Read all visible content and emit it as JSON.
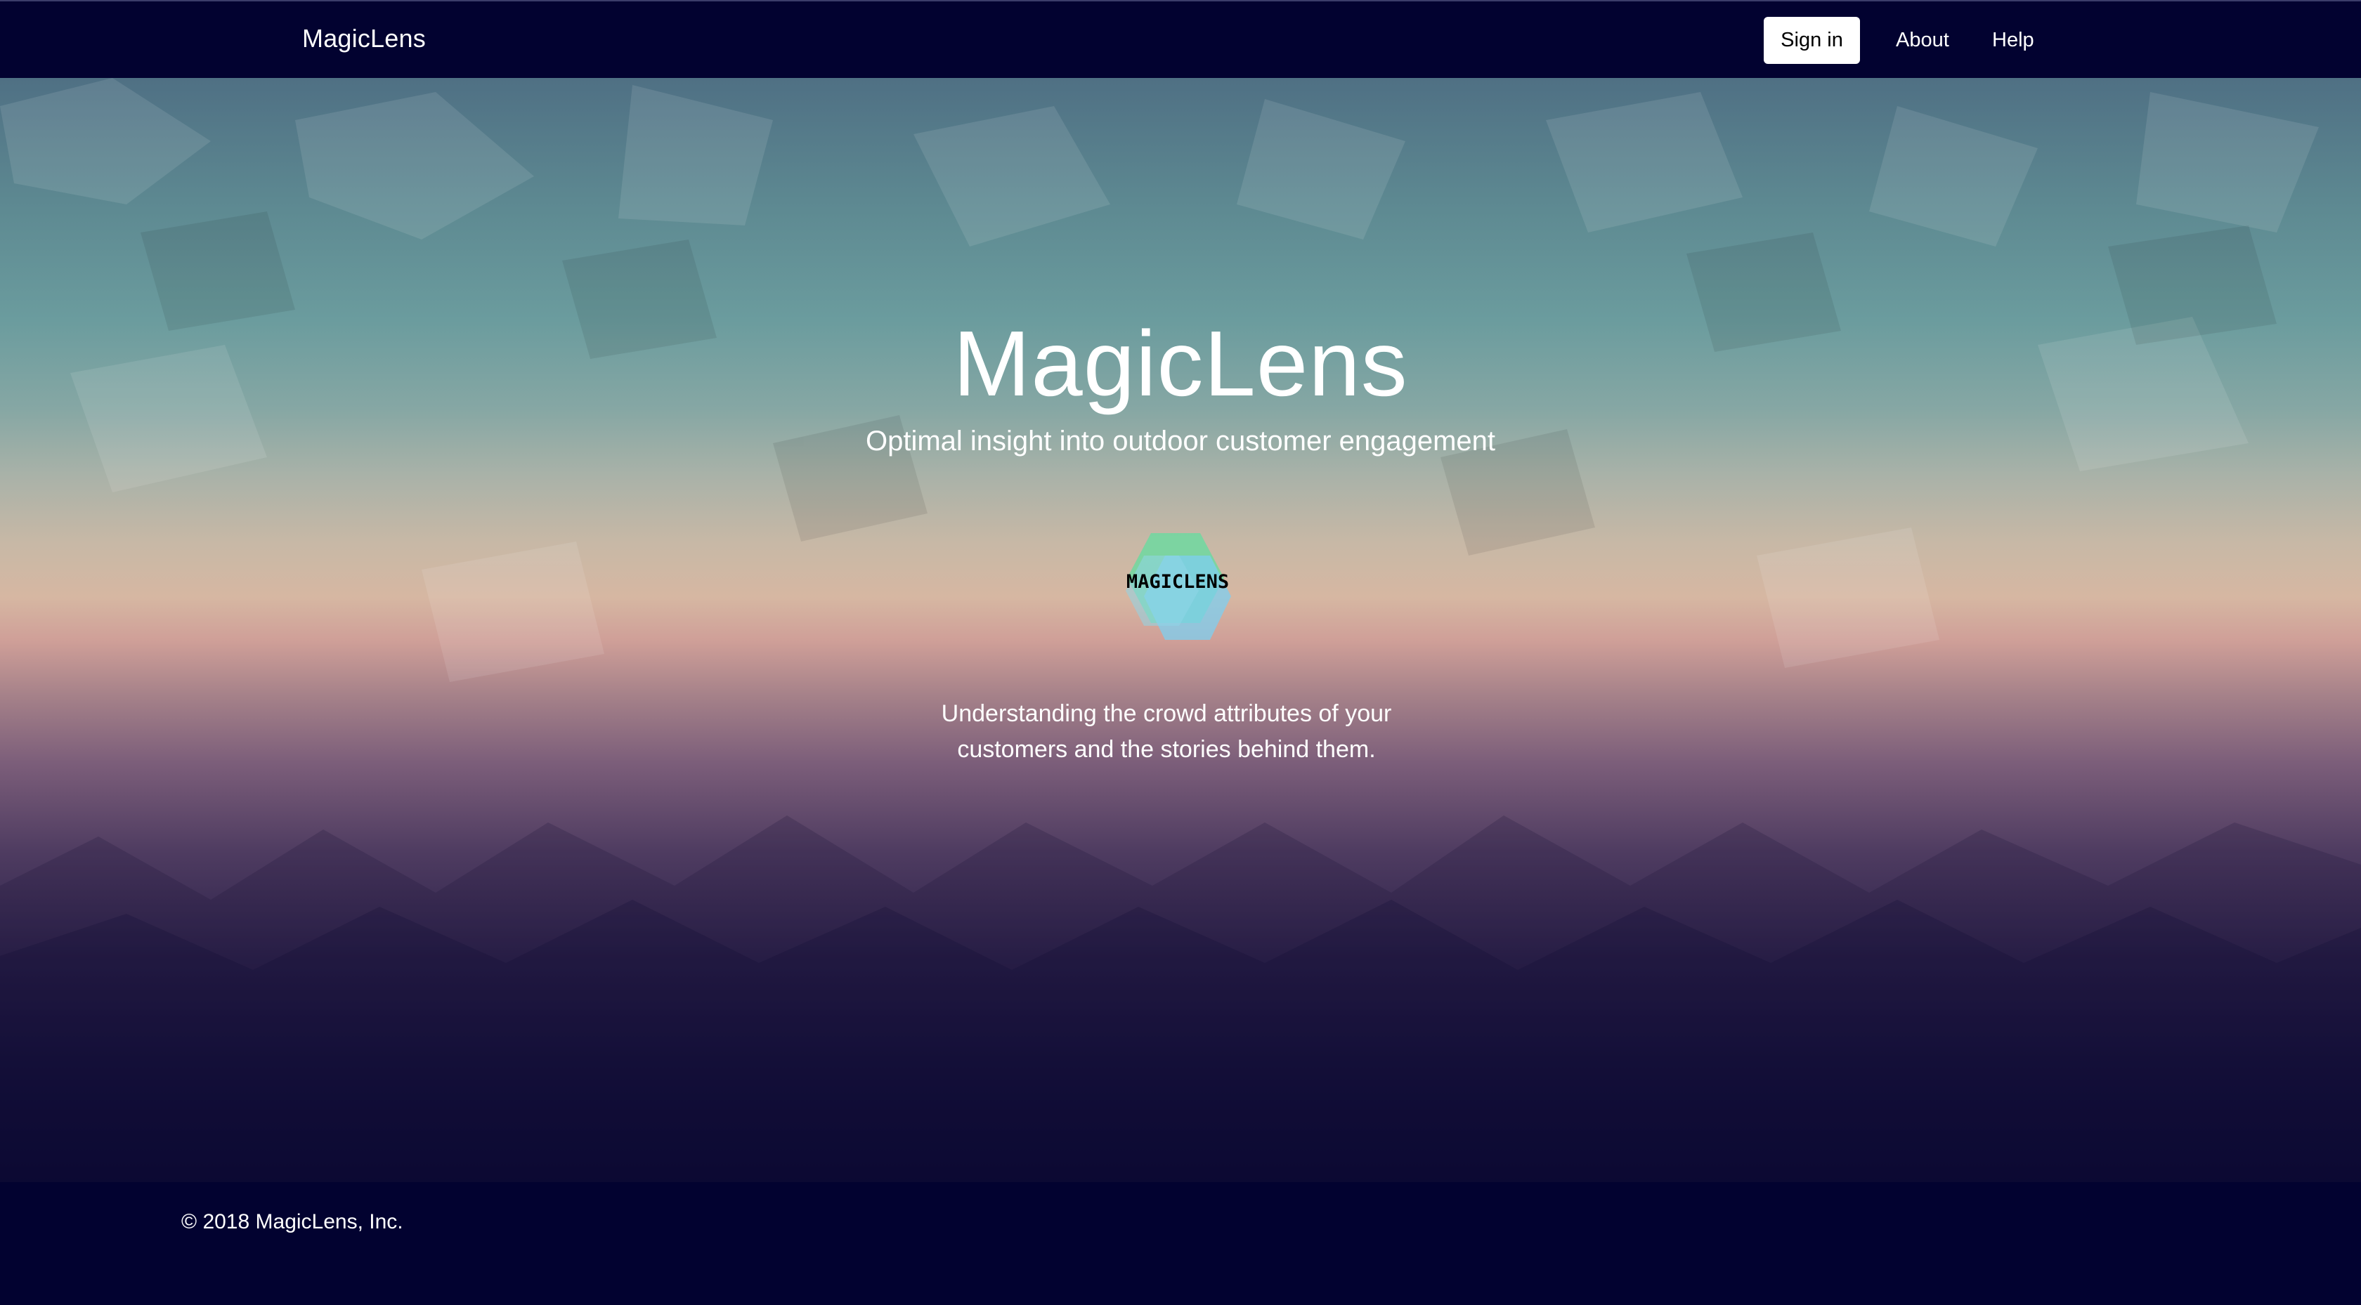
{
  "nav": {
    "brand": "MagicLens",
    "signin_label": "Sign in",
    "links": [
      "About",
      "Help"
    ]
  },
  "hero": {
    "title": "MagicLens",
    "subtitle": "Optimal insight into outdoor customer engagement",
    "logo_text": "MAGICLENS",
    "description_line1": "Understanding the crowd attributes of your",
    "description_line2": "customers and the stories behind them."
  },
  "footer": {
    "copyright": "© 2018 MagicLens, Inc."
  },
  "colors": {
    "navbar_bg": "#020230",
    "footer_bg": "#020230",
    "signin_bg": "#ffffff",
    "hero_top": "#4f7084",
    "hero_mid": "#d6b7a2",
    "hero_bottom": "#060632",
    "logo_green": "#6fd8a0",
    "logo_blue": "#7ecff0"
  },
  "icons": {
    "logo": "magiclens-hexagon-logo"
  }
}
